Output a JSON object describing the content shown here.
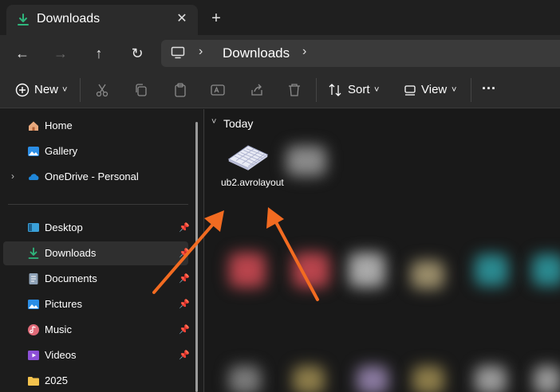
{
  "window": {
    "tab_title": "Downloads",
    "tab_close_glyph": "✕",
    "new_tab_glyph": "+"
  },
  "nav": {
    "back_glyph": "←",
    "forward_glyph": "→",
    "up_glyph": "↑",
    "refresh_glyph": "↻",
    "breadcrumb": [
      "Downloads"
    ],
    "separator_glyph": "›"
  },
  "toolbar": {
    "new_label": "New",
    "sort_label": "Sort",
    "view_label": "View",
    "more_glyph": "···",
    "caret_glyph": "˅"
  },
  "sidebar": {
    "items": [
      {
        "label": "Home",
        "icon": "home-icon",
        "pinned": false
      },
      {
        "label": "Gallery",
        "icon": "gallery-icon",
        "pinned": false
      },
      {
        "label": "OneDrive - Personal",
        "icon": "onedrive-icon",
        "pinned": false,
        "expandable": true
      },
      {
        "label": "Desktop",
        "icon": "desktop-icon",
        "pinned": true
      },
      {
        "label": "Downloads",
        "icon": "download-icon",
        "pinned": true,
        "selected": true
      },
      {
        "label": "Documents",
        "icon": "documents-icon",
        "pinned": true
      },
      {
        "label": "Pictures",
        "icon": "pictures-icon",
        "pinned": true
      },
      {
        "label": "Music",
        "icon": "music-icon",
        "pinned": true
      },
      {
        "label": "Videos",
        "icon": "videos-icon",
        "pinned": true
      },
      {
        "label": "2025",
        "icon": "folder-icon",
        "pinned": false
      }
    ],
    "pin_glyph": "📌",
    "expander_glyph": "›"
  },
  "content": {
    "group_header": "Today",
    "group_chevron": "˅",
    "highlighted_file": {
      "name": "ub2.avrolayout",
      "icon": "keyboard-icon"
    }
  },
  "colors": {
    "accent": "#4cc2ff",
    "download_green": "#2fb67c",
    "annotation_arrow": "#f26b21",
    "window_bg": "#1c1c1c",
    "chrome_bg": "#2b2b2b"
  }
}
